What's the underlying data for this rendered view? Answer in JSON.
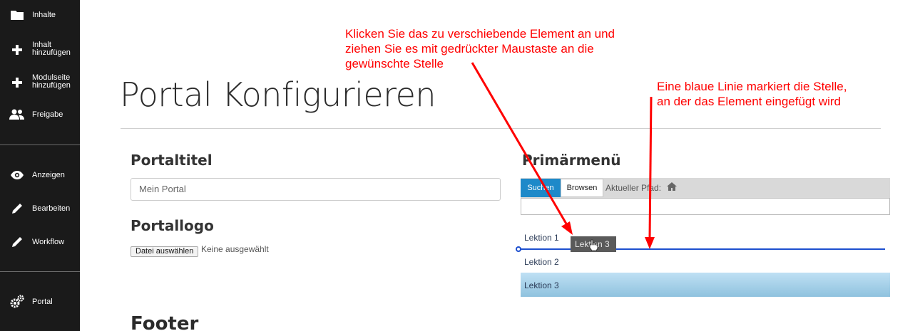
{
  "sidebar": {
    "items": [
      {
        "label": "Inhalte",
        "icon": "folder-icon"
      },
      {
        "label": "Inhalt\nhinzufügen",
        "icon": "plus-icon"
      },
      {
        "label": "Modulseite\nhinzufügen",
        "icon": "plus-icon"
      },
      {
        "label": "Freigabe",
        "icon": "users-icon"
      },
      {
        "label": "Anzeigen",
        "icon": "eye-icon"
      },
      {
        "label": "Bearbeiten",
        "icon": "pencil-icon"
      },
      {
        "label": "Workflow",
        "icon": "pencil-icon"
      },
      {
        "label": "Portal",
        "icon": "gears-icon"
      }
    ]
  },
  "page": {
    "title": "Portal Konfigurieren"
  },
  "portal_title": {
    "heading": "Portaltitel",
    "value": "Mein Portal"
  },
  "portal_logo": {
    "heading": "Portallogo",
    "button_label": "Datei auswählen",
    "no_file_text": "Keine ausgewählt"
  },
  "primary_menu": {
    "heading": "Primärmenü",
    "tab_search": "Suchen",
    "tab_browse": "Browsen",
    "path_label": "Aktueller Pfad:",
    "lessons": [
      "Lektion 1",
      "Lektion 2",
      "Lektion 3"
    ],
    "drag_ghost_label": "Lektion 3"
  },
  "footer": {
    "heading": "Footer"
  },
  "annotations": {
    "note_drag": [
      "Klicken Sie das zu verschiebende Element an und",
      "ziehen Sie es mit gedrückter Maustaste an die",
      "gewünschte Stelle"
    ],
    "note_line": [
      "Eine blaue Linie markiert die Stelle,",
      "an der das Element eingefügt wird"
    ]
  },
  "colors": {
    "sidebar_bg": "#1a1a1a",
    "accent": "#1d89c9",
    "annotation": "#ff0000",
    "drop_line": "#1d4fcf"
  }
}
